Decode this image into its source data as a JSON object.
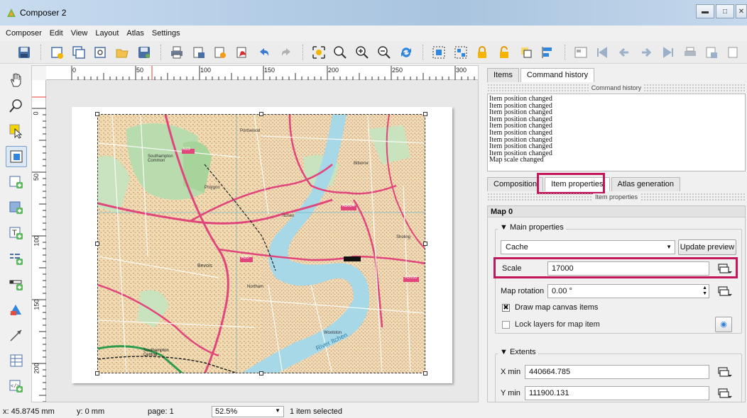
{
  "window": {
    "title": "Composer 2",
    "controls": [
      "minimize",
      "maximize",
      "close"
    ]
  },
  "menu": [
    "Composer",
    "Edit",
    "View",
    "Layout",
    "Atlas",
    "Settings"
  ],
  "toolbar_icons": [
    "save-icon",
    "new-composer-icon",
    "duplicate-composer-icon",
    "composer-manager-icon",
    "open-template-icon",
    "save-template-icon",
    "print-icon",
    "export-image-icon",
    "export-svg-icon",
    "export-pdf-icon",
    "undo-icon",
    "redo-icon",
    "zoom-full-icon",
    "zoom-100-icon",
    "zoom-in-icon",
    "zoom-out-icon",
    "refresh-icon",
    "group-icon",
    "ungroup-icon",
    "lock-icon",
    "unlock-icon",
    "raise-icon",
    "align-icon",
    "atlas-preview-icon",
    "first-feature-icon",
    "previous-feature-icon",
    "next-feature-icon",
    "last-feature-icon",
    "atlas-print-icon",
    "atlas-export-icon",
    "atlas-settings-icon"
  ],
  "left_tools": [
    "pan-icon",
    "zoom-tool-icon",
    "select-move-icon",
    "move-content-icon",
    "add-map-icon",
    "add-image-icon",
    "add-label-icon",
    "add-legend-icon",
    "add-scalebar-icon",
    "add-shape-icon",
    "add-arrow-icon",
    "add-table-icon",
    "add-html-icon"
  ],
  "ruler": {
    "h_labels": [
      "0",
      "50",
      "100",
      "150",
      "200",
      "250",
      "300"
    ],
    "v_labels": [
      "0",
      "50",
      "100",
      "150",
      "200"
    ]
  },
  "map": {
    "labels": [
      "A33",
      "A3024",
      "Southampton Common",
      "Bitterne",
      "Itchen",
      "Bevois",
      "Polygon",
      "A3035",
      "Northam",
      "Woolston",
      "River Itchen",
      "Southampton Central",
      "A35",
      "Portswood",
      "Sholing"
    ]
  },
  "right_panel": {
    "top_tabs": [
      "Items",
      "Command history"
    ],
    "history_title": "Command history",
    "history": [
      "Item position changed",
      "Item position changed",
      "Item position changed",
      "Item position changed",
      "Item position changed",
      "Item position changed",
      "Item position changed",
      "Item position changed",
      "Item position changed",
      "Map scale changed"
    ],
    "bottom_tabs": [
      "Composition",
      "Item properties",
      "Atlas generation"
    ],
    "props_title": "Item properties",
    "item_name": "Map 0",
    "main_properties_label": "Main properties",
    "cache_value": "Cache",
    "update_preview": "Update preview",
    "scale_label": "Scale",
    "scale_value": "17000",
    "rotation_label": "Map rotation",
    "rotation_value": "0.00 °",
    "draw_canvas_items": "Draw map canvas items",
    "draw_canvas_checked": true,
    "lock_layers": "Lock layers for map item",
    "lock_layers_checked": false,
    "extents_label": "Extents",
    "xmin_label": "X min",
    "xmin_value": "440664.785",
    "ymin_label": "Y min",
    "ymin_value": "111900.131"
  },
  "status": {
    "x": "x: 45.8745 mm",
    "y": "y: 0 mm",
    "page": "page: 1",
    "zoom": "52.5%",
    "selection": "1 item selected"
  },
  "colors": {
    "highlight": "#c2185b",
    "map_road_major": "#e0457b",
    "water": "#a6d8e8",
    "green": "#b8dcae"
  }
}
